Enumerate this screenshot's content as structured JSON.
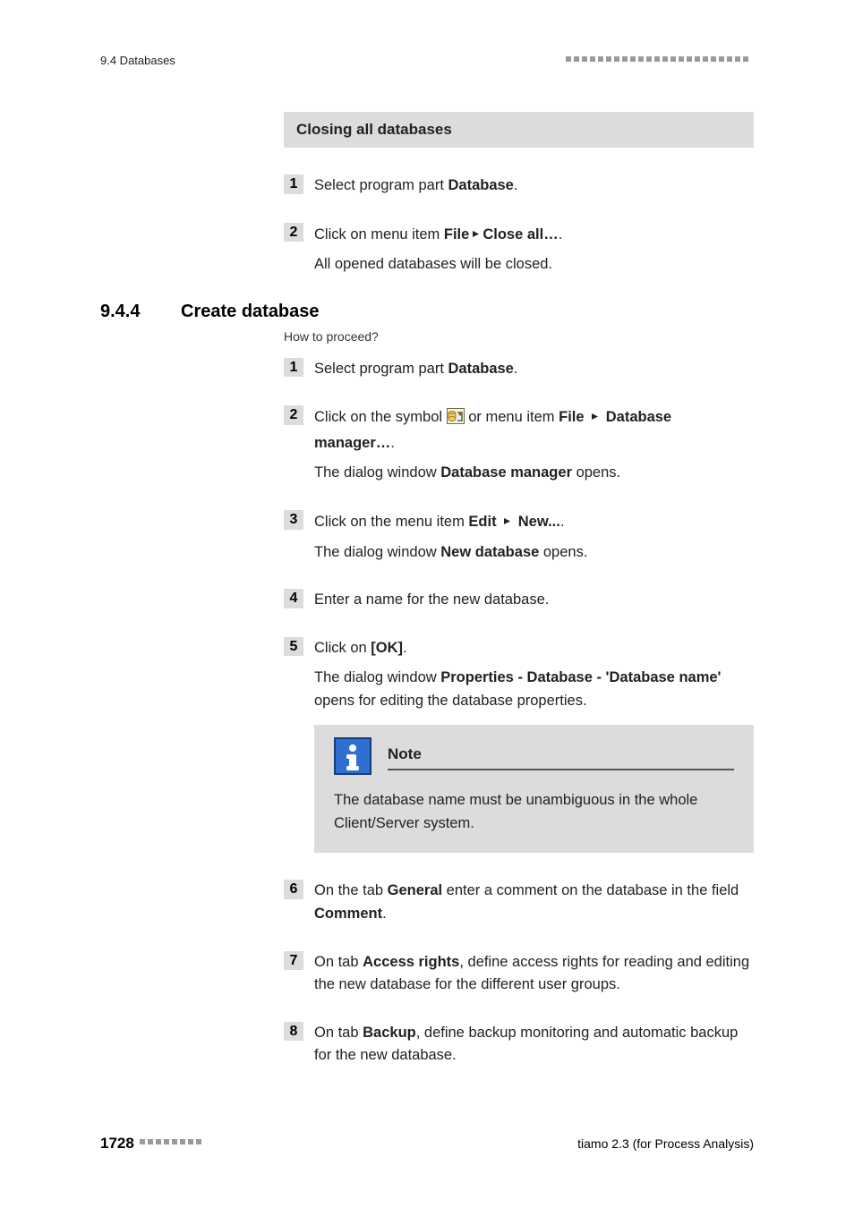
{
  "header": {
    "left": "9.4 Databases"
  },
  "sectionA": {
    "title": "Closing all databases",
    "steps": [
      {
        "num": "1",
        "pre": "Select program part ",
        "bold": "Database",
        "post": "."
      },
      {
        "num": "2",
        "pre": "Click on menu item ",
        "bold1": "File",
        "arrow": true,
        "bold2": "Close all…",
        "post": ".",
        "sub": "All opened databases will be closed."
      }
    ]
  },
  "sectionB": {
    "num": "9.4.4",
    "title": "Create database",
    "howto": "How to proceed?",
    "steps": {
      "s1": {
        "num": "1",
        "pre": "Select program part ",
        "b": "Database",
        "post": "."
      },
      "s2": {
        "num": "2",
        "pre": "Click on the symbol ",
        "mid": " or menu item ",
        "b1": "File",
        "b2": "Database manager…",
        "post": ".",
        "sub_pre": "The dialog window ",
        "sub_b": "Database manager",
        "sub_post": " opens."
      },
      "s3": {
        "num": "3",
        "pre": "Click on the menu item ",
        "b1": "Edit",
        "b2": "New...",
        "post": ".",
        "sub_pre": "The dialog window ",
        "sub_b": "New database",
        "sub_post": " opens."
      },
      "s4": {
        "num": "4",
        "text": "Enter a name for the new database."
      },
      "s5": {
        "num": "5",
        "pre": "Click on ",
        "b": "[OK]",
        "post": ".",
        "sub_pre": "The dialog window ",
        "sub_b": "Properties - Database - 'Database name'",
        "sub_post": " opens for editing the database properties.",
        "note_title": "Note",
        "note_body": "The database name must be unambiguous in the whole Client/Server system."
      },
      "s6": {
        "num": "6",
        "pre": "On the tab ",
        "b1": "General",
        "mid": " enter a comment on the database in the field ",
        "b2": "Comment",
        "post": "."
      },
      "s7": {
        "num": "7",
        "pre": "On tab ",
        "b": "Access rights",
        "post": ", define access rights for reading and editing the new database for the different user groups."
      },
      "s8": {
        "num": "8",
        "pre": "On tab ",
        "b": "Backup",
        "post": ", define backup monitoring and automatic backup for the new database."
      }
    }
  },
  "footer": {
    "page": "1728",
    "right": "tiamo 2.3 (for Process Analysis)"
  }
}
